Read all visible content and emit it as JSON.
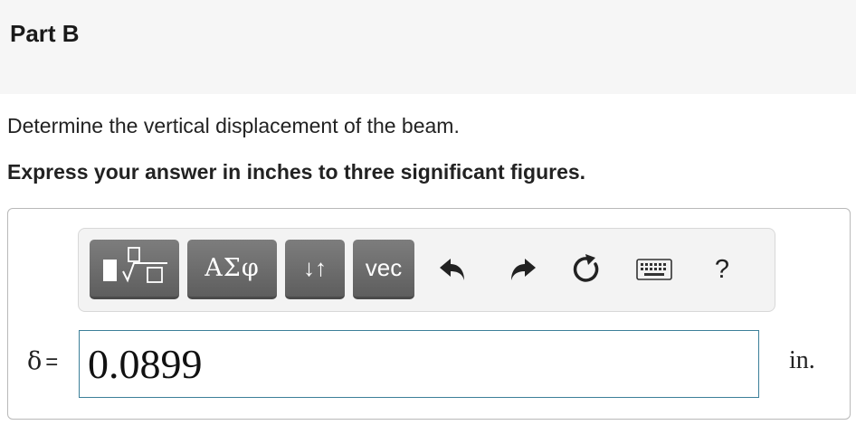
{
  "part": {
    "title": "Part B"
  },
  "question": {
    "text": "Determine the vertical displacement of the beam."
  },
  "instruction": {
    "text": "Express your answer in inches to three significant figures."
  },
  "toolbar": {
    "buttons": [
      {
        "name": "templates",
        "icon": "templates-icon"
      },
      {
        "name": "greek",
        "label": "ΑΣφ"
      },
      {
        "name": "subscript-superscript",
        "label": "↓↑"
      },
      {
        "name": "vector",
        "label": "vec"
      }
    ],
    "icons": [
      "undo-icon",
      "redo-icon",
      "reset-icon",
      "keyboard-icon",
      "help-icon"
    ],
    "help_label": "?"
  },
  "answer": {
    "variable": "δ",
    "equals": "=",
    "value": "0.0899",
    "units": "in."
  },
  "colors": {
    "header_bg": "#f6f6f6",
    "button_bg": "#6e6e6e",
    "input_border": "#3c7f99"
  }
}
